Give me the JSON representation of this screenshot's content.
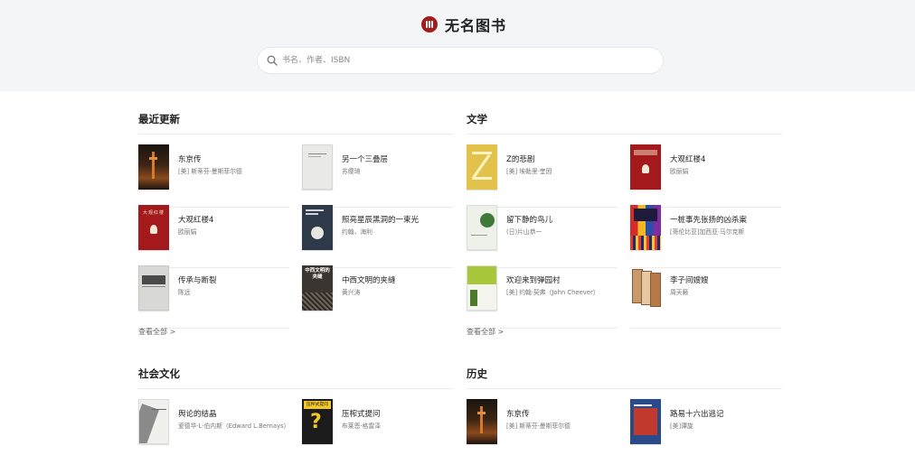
{
  "site": {
    "name": "无名图书"
  },
  "search": {
    "placeholder": "书名、作者、ISBN"
  },
  "sections": [
    {
      "title": "最近更新",
      "view_all": "查看全部 >",
      "books": [
        {
          "title": "东京传",
          "author": "[美] 斯蒂芬·曼斯菲尔德"
        },
        {
          "title": "另一个三叠层",
          "author": "苏缨琦"
        },
        {
          "title": "大观红楼4",
          "author": "欧丽娟"
        },
        {
          "title": "照亮星辰黑洞的一束光",
          "author": "约翰、海利"
        },
        {
          "title": "传承与断裂",
          "author": "陈远"
        },
        {
          "title": "中西文明的夹缝",
          "author": "黄兴涛"
        }
      ]
    },
    {
      "title": "文学",
      "view_all": "查看全部 >",
      "books": [
        {
          "title": "Z的悲剧",
          "author": "[美] 埃勒里·奎因"
        },
        {
          "title": "大观红楼4",
          "author": "欧丽娟"
        },
        {
          "title": "留下静的鸟儿",
          "author": "(日)片山恭一"
        },
        {
          "title": "一桩事先张扬的凶杀案",
          "author": "[哥伦比亚]加西亚·马尔克斯"
        },
        {
          "title": "欢迎来到弹园村",
          "author": "[美] 约翰·契弗（John Cheever）"
        },
        {
          "title": "李子间嫂嫂",
          "author": "周天籁"
        }
      ]
    },
    {
      "title": "社会文化",
      "books": [
        {
          "title": "舆论的结晶",
          "author": "爱德华·L·伯内斯（Edward L.Bernays）"
        },
        {
          "title": "压榨式提问",
          "author": "布莱恩·格雷泽"
        }
      ]
    },
    {
      "title": "历史",
      "books": [
        {
          "title": "东京传",
          "author": "[美] 斯蒂芬·曼斯菲尔德"
        },
        {
          "title": "路易十六出逃记",
          "author": "[美]谭旋"
        }
      ]
    }
  ],
  "cover_texts": {
    "hongloumeng": "大观红楼",
    "zhongxi": "中西文明的夹缝",
    "yazha": "压榨式提问"
  },
  "colors": {
    "brand": "#a31c1c",
    "header_bg": "#f4f5f7",
    "search_bg": "#ffffff",
    "divider": "#ececec"
  }
}
